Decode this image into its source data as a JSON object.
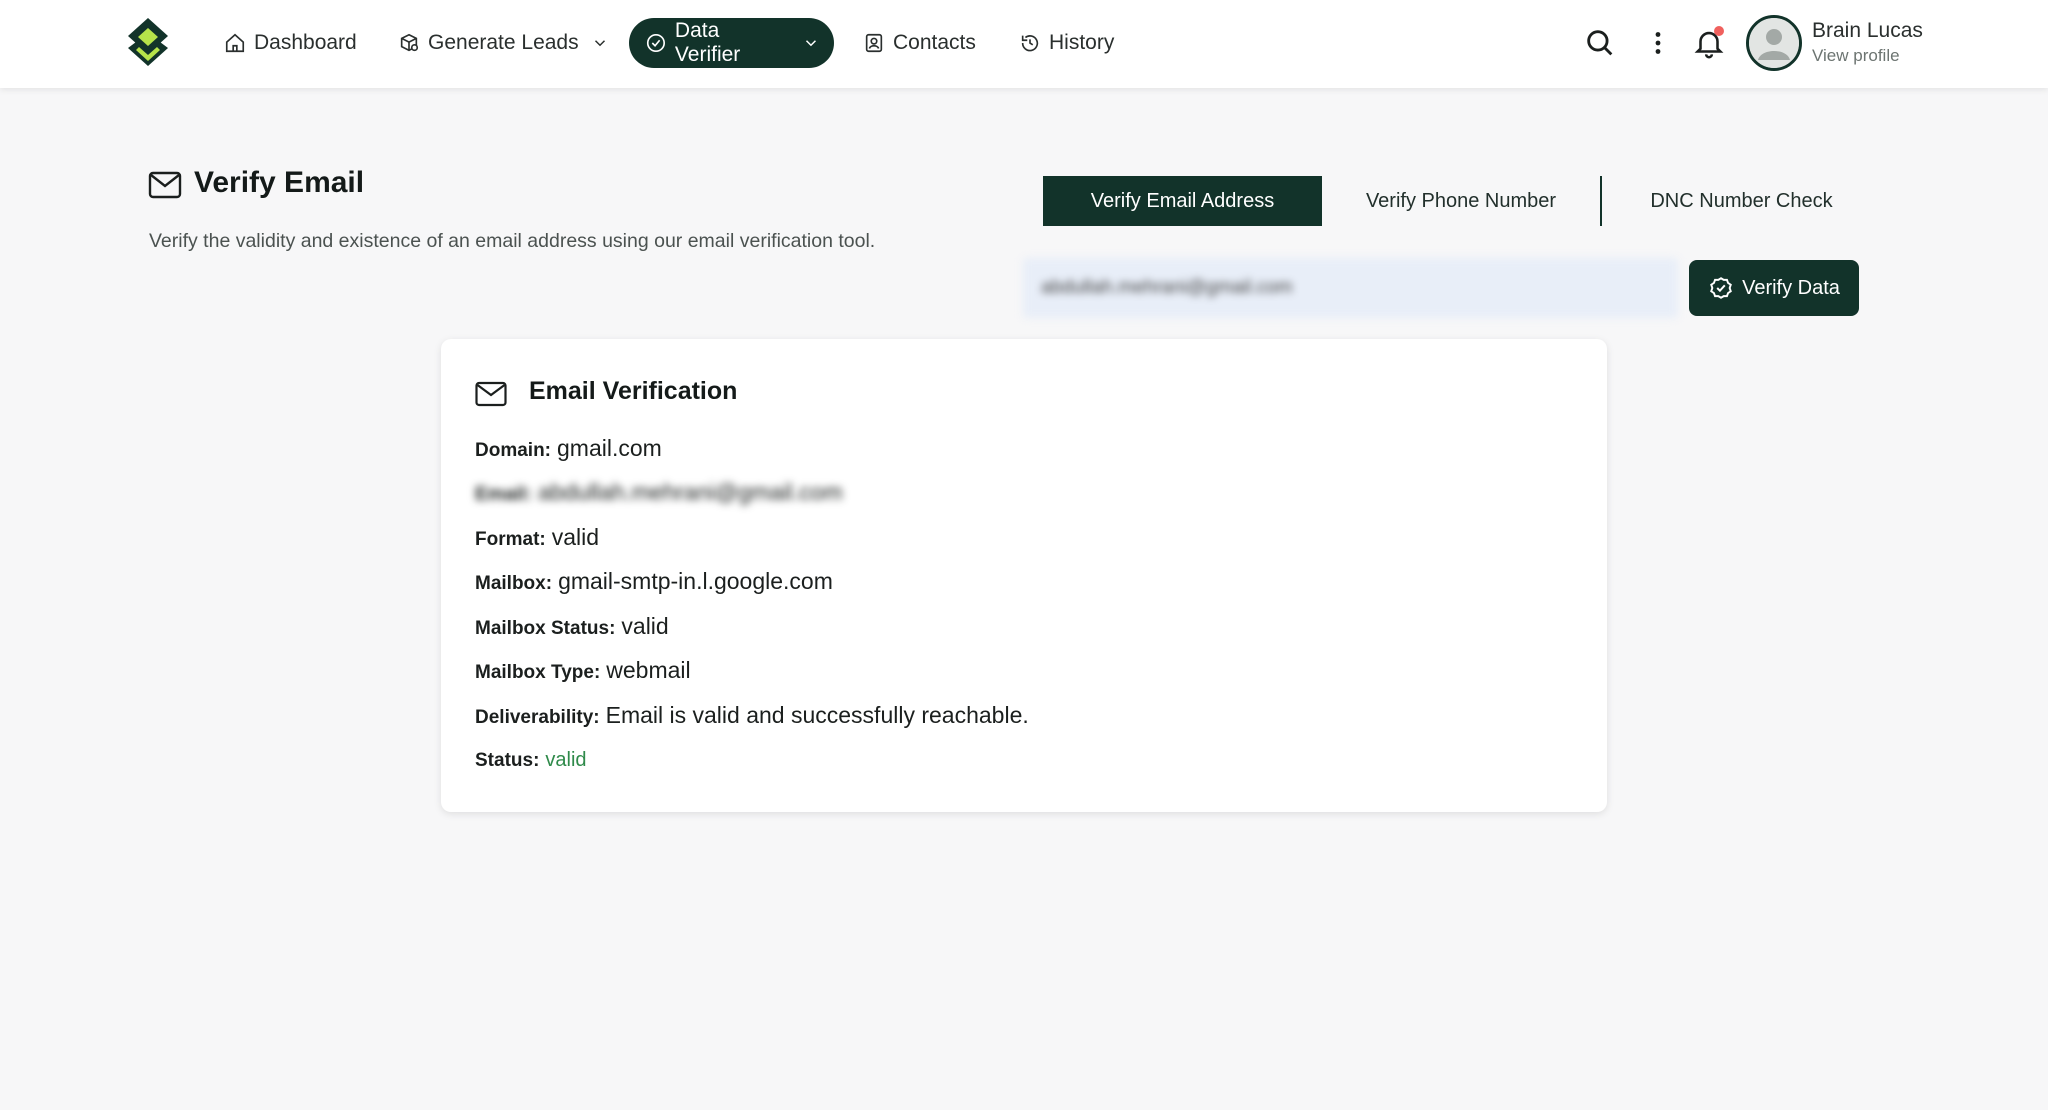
{
  "nav": {
    "items": [
      {
        "label": "Dashboard",
        "icon": "home-icon"
      },
      {
        "label": "Generate Leads",
        "icon": "leads-icon",
        "dropdown": true
      },
      {
        "label": "Data Verifier",
        "icon": "check-circle-icon",
        "dropdown": true,
        "active": true
      },
      {
        "label": "Contacts",
        "icon": "contact-icon"
      },
      {
        "label": "History",
        "icon": "history-icon"
      }
    ]
  },
  "user": {
    "name": "Brain Lucas",
    "link": "View profile"
  },
  "header": {
    "title": "Verify Email",
    "description": "Verify the validity and existence of an email address using our email verification tool."
  },
  "tabs": [
    {
      "label": "Verify Email Address",
      "active": true
    },
    {
      "label": "Verify Phone Number"
    },
    {
      "label": "DNC Number Check"
    }
  ],
  "search": {
    "value": "abdullah.mehrani@gmail.com",
    "button": "Verify Data"
  },
  "result": {
    "title": "Email Verification",
    "rows": [
      {
        "label": "Domain:",
        "value": "gmail.com"
      },
      {
        "label": "Email:",
        "value": "abdullah.mehrani@gmail.com"
      },
      {
        "label": "Format:",
        "value": "valid"
      },
      {
        "label": "Mailbox:",
        "value": "gmail-smtp-in.l.google.com"
      },
      {
        "label": "Mailbox Status:",
        "value": "valid"
      },
      {
        "label": "Mailbox Type:",
        "value": "webmail"
      },
      {
        "label": "Deliverability:",
        "value": "Email is valid and successfully reachable."
      },
      {
        "label": "Status:",
        "value": "valid"
      }
    ]
  },
  "colors": {
    "primary": "#12332a",
    "accent": "#b6e34a",
    "valid": "#2f8a4a",
    "notification": "#f0605d"
  }
}
